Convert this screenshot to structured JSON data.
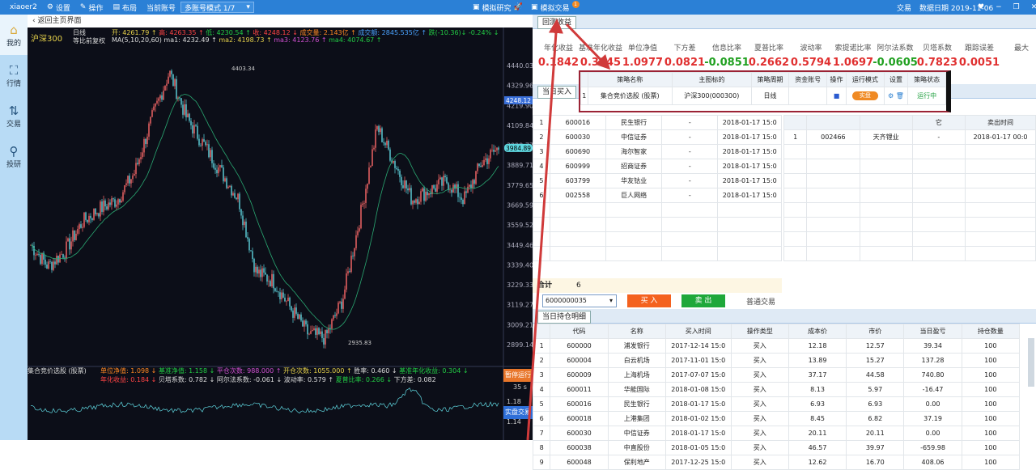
{
  "topbar": {
    "user": "xiaoer2",
    "settings": "设置",
    "operate": "操作",
    "layout": "布局",
    "current_account_label": "当前账号",
    "account_mode": "多账号模式 1/7",
    "research": "模拟研究",
    "sim_trade": "模拟交易",
    "badge": "1",
    "trade": "交易",
    "data_date": "数据日期 2019-11-06"
  },
  "sidebar": [
    {
      "label": "我的",
      "icon": "home"
    },
    {
      "label": "行情",
      "icon": "chart"
    },
    {
      "label": "交易",
      "icon": "arrows"
    },
    {
      "label": "投研",
      "icon": "magnifier"
    }
  ],
  "left": {
    "back": "‹ 返回主页界面",
    "symbol": "沪深300",
    "period": "日线",
    "adjust": "等比前复权",
    "quote": {
      "open": "开: 4261.79 ↑",
      "high": "高: 4263.35 ↑",
      "low": "低: 4230.54 ↑",
      "close": "收: 4248.12 ↓",
      "vol": "成交量: 2.143亿 ↑",
      "amt": "成交额: 2845.535亿 ↑",
      "chg": "跌(-10.36)↓ -0.24% ↓"
    },
    "ma": {
      "label": "MA(5,10,20,60)",
      "ma1": "ma1: 4232.49 ↑",
      "ma2": "ma2: 4198.73 ↑",
      "ma3": "ma3: 4123.76 ↑",
      "ma4": "ma4: 4074.67 ↑"
    },
    "indicator": {
      "name": "集合竞价选股 (股票)",
      "line1": [
        {
          "t": "单位净值: 1.098 ↓",
          "c": "o"
        },
        {
          "t": "基准净值: 1.158 ↓",
          "c": "g"
        },
        {
          "t": "平仓次数: 988.000 ↑",
          "c": "m"
        },
        {
          "t": "开仓次数: 1055.000 ↑",
          "c": "y"
        },
        {
          "t": "胜率: 0.460 ↓",
          "c": "w"
        },
        {
          "t": "基准年化收益: 0.304 ↓",
          "c": "g"
        }
      ],
      "line2": [
        {
          "t": "年化收益: 0.184 ↓",
          "c": "r"
        },
        {
          "t": "贝塔系数: 0.782 ↓",
          "c": "w"
        },
        {
          "t": "阿尔法系数: -0.061 ↓",
          "c": "w"
        },
        {
          "t": "波动率: 0.579 ↑",
          "c": "w"
        },
        {
          "t": "夏普比率: 0.266 ↓",
          "c": "g"
        },
        {
          "t": "下方差: 0.082",
          "c": "w"
        }
      ]
    },
    "stop_btn": "暂停运行",
    "timer": "35 s",
    "live_btn": "实盘交易",
    "sub_ticks": [
      "1.18",
      "1.14"
    ]
  },
  "chart_data": {
    "type": "candlestick",
    "title": "沪深300 日线",
    "y_ticks": [
      4440.03,
      4329.96,
      4219.9,
      4109.84,
      3999.77,
      3889.71,
      3779.65,
      3669.59,
      3559.52,
      3449.46,
      3339.4,
      3229.33,
      3119.27,
      3009.21,
      2899.14
    ],
    "ylim": [
      2899.14,
      4440.03
    ],
    "last_price": "4248.12",
    "cursor_price": "3984.89",
    "annotations": [
      "4403.34",
      "2935.83"
    ],
    "path": [
      3450,
      3330,
      3420,
      3580,
      3650,
      3700,
      3850,
      4150,
      4403.34,
      4150,
      4000,
      3850,
      3700,
      3300,
      3250,
      3100,
      2960,
      2935.83,
      3150,
      3600,
      4100,
      3900,
      3700,
      3750,
      3800,
      3700,
      3900,
      3985
    ]
  },
  "right": {
    "tab": "回测收益",
    "metrics": [
      {
        "l": "年化收益",
        "v": "0.1842",
        "c": "#e03030"
      },
      {
        "l": "基准年化收益",
        "v": "0.3045",
        "c": "#e03030"
      },
      {
        "l": "单位净值",
        "v": "1.0977",
        "c": "#e03030"
      },
      {
        "l": "下方差",
        "v": "0.0821",
        "c": "#e03030"
      },
      {
        "l": "信息比率",
        "v": "-0.0851",
        "c": "#20a020"
      },
      {
        "l": "夏普比率",
        "v": "0.2662",
        "c": "#e03030"
      },
      {
        "l": "波动率",
        "v": "0.5794",
        "c": "#e03030"
      },
      {
        "l": "索提诺比率",
        "v": "1.0697",
        "c": "#e03030"
      },
      {
        "l": "阿尔法系数",
        "v": "-0.0605",
        "c": "#20a020"
      },
      {
        "l": "贝塔系数",
        "v": "0.7823",
        "c": "#e03030"
      },
      {
        "l": "跟踪误差",
        "v": "0.0051",
        "c": "#e03030"
      },
      {
        "l": "最大",
        "v": "",
        "c": "#e03030"
      }
    ],
    "buy_tab": "当日买入",
    "buy_rows": [
      [
        "1",
        "600016",
        "民生银行",
        "-",
        "2018-01-17 15:0"
      ],
      [
        "2",
        "600030",
        "中信证券",
        "-",
        "2018-01-17 15:0"
      ],
      [
        "3",
        "600690",
        "海尔智家",
        "-",
        "2018-01-17 15:0"
      ],
      [
        "4",
        "600999",
        "招商证券",
        "-",
        "2018-01-17 15:0"
      ],
      [
        "5",
        "603799",
        "华友钴业",
        "-",
        "2018-01-17 15:0"
      ],
      [
        "6",
        "002558",
        "巨人网络",
        "-",
        "2018-01-17 15:0"
      ]
    ],
    "sell_header": [
      "",
      "",
      "",
      "它",
      "卖出时间"
    ],
    "sell_rows": [
      [
        "1",
        "002466",
        "天齐锂业",
        "-",
        "2018-01-17 00:0"
      ]
    ],
    "total_label": "合计",
    "total_value": "6",
    "code_input": "6000000035",
    "buy_btn": "买 入",
    "sell_btn": "卖 出",
    "normal_trade": "普通交易",
    "hold_tab": "当日持仓明细",
    "hold_header": [
      "",
      "代码",
      "名称",
      "买入时间",
      "操作类型",
      "成本价",
      "市价",
      "当日盈亏",
      "持仓数量"
    ],
    "hold_rows": [
      [
        "1",
        "600000",
        "浦发银行",
        "2017-12-14 15:0",
        "买入",
        "12.18",
        "12.57",
        "39.34",
        "100"
      ],
      [
        "2",
        "600004",
        "白云机场",
        "2017-11-01 15:0",
        "买入",
        "13.89",
        "15.27",
        "137.28",
        "100"
      ],
      [
        "3",
        "600009",
        "上海机场",
        "2017-07-07 15:0",
        "买入",
        "37.17",
        "44.58",
        "740.80",
        "100"
      ],
      [
        "4",
        "600011",
        "华能国际",
        "2018-01-08 15:0",
        "买入",
        "8.13",
        "5.97",
        "-16.47",
        "100"
      ],
      [
        "5",
        "600016",
        "民生银行",
        "2018-01-17 15:0",
        "买入",
        "6.93",
        "6.93",
        "0.00",
        "100"
      ],
      [
        "6",
        "600018",
        "上港集团",
        "2018-01-02 15:0",
        "买入",
        "8.45",
        "6.82",
        "37.19",
        "100"
      ],
      [
        "7",
        "600030",
        "中信证券",
        "2018-01-17 15:0",
        "买入",
        "20.11",
        "20.11",
        "0.00",
        "100"
      ],
      [
        "8",
        "600038",
        "中直股份",
        "2018-01-05 15:0",
        "买入",
        "46.57",
        "39.97",
        "-659.98",
        "100"
      ],
      [
        "9",
        "600048",
        "保利地产",
        "2017-12-25 15:0",
        "买入",
        "12.62",
        "16.70",
        "408.06",
        "100"
      ]
    ]
  },
  "popup": {
    "header": [
      "",
      "策略名称",
      "主图标的",
      "策略周期",
      "资金账号",
      "操作",
      "运行模式",
      "设置",
      "策略状态"
    ],
    "row": {
      "idx": "1",
      "name": "集合竞价选股 (股票)",
      "target": "沪深300(000300)",
      "period": "日线",
      "account": "",
      "mode": "实盘",
      "status": "运行中"
    }
  }
}
